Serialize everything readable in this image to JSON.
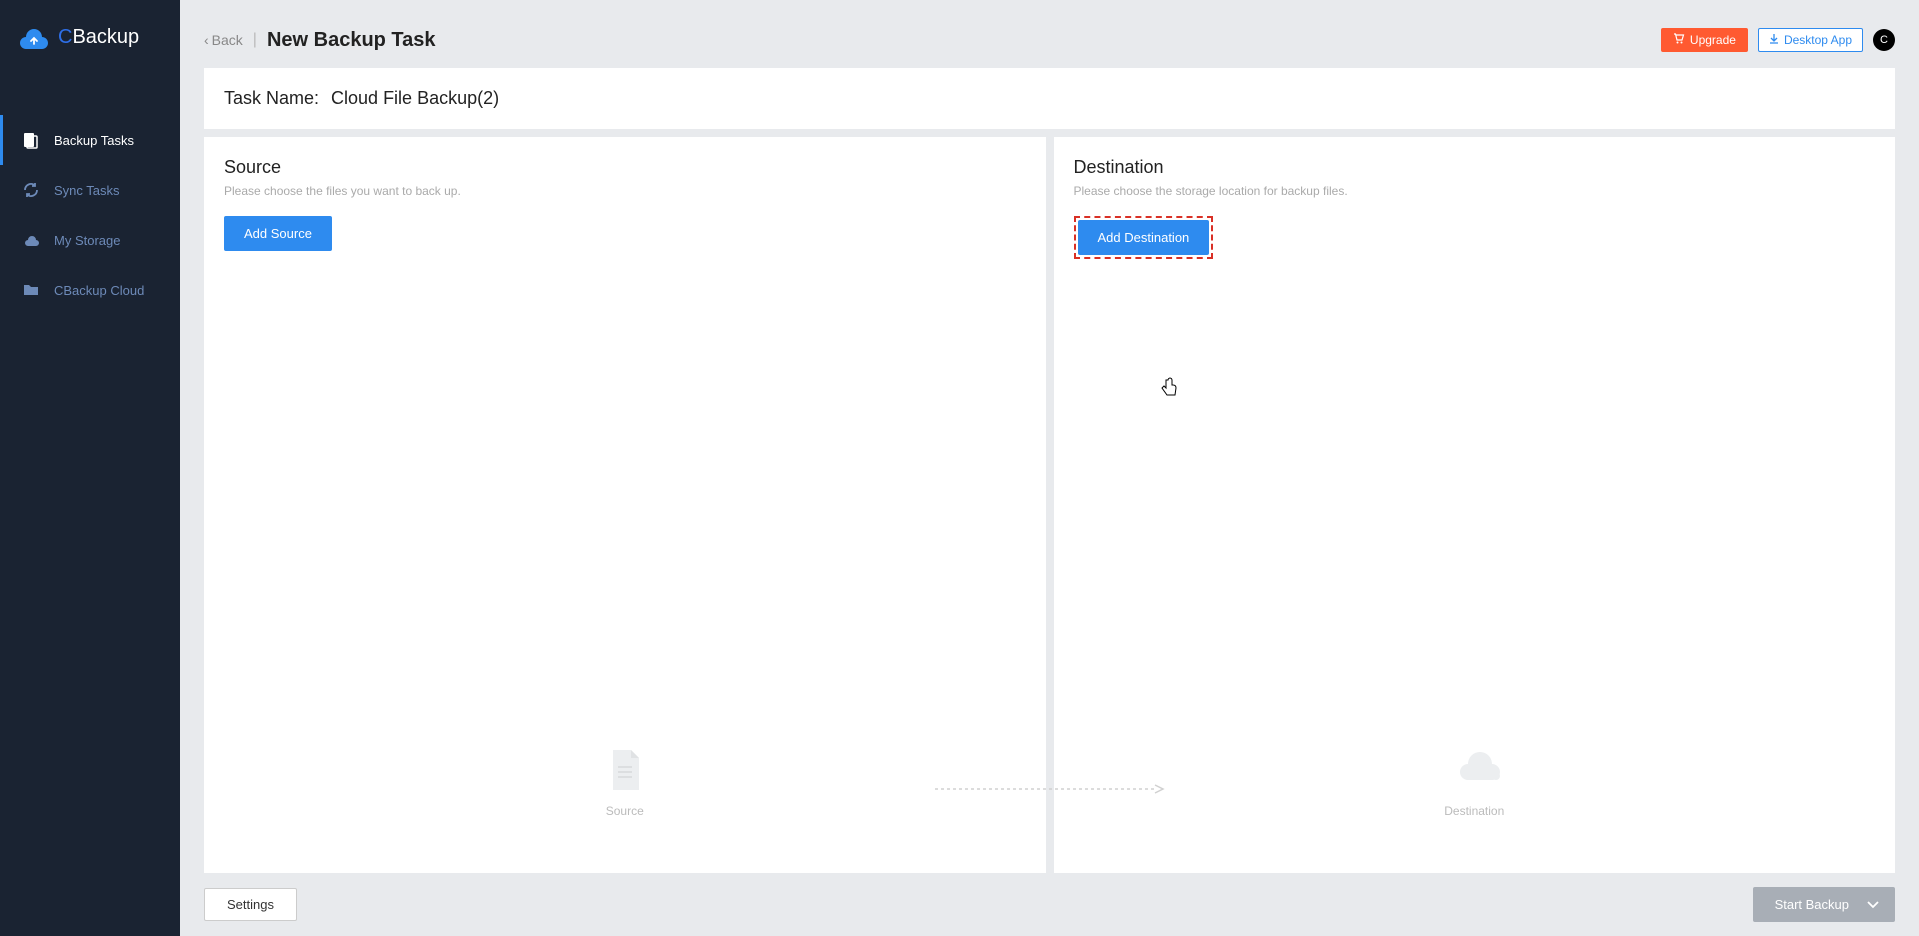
{
  "logo": {
    "prefix": "C",
    "rest": "Backup"
  },
  "sidebar": {
    "items": [
      {
        "label": "Backup Tasks",
        "icon": "backup"
      },
      {
        "label": "Sync Tasks",
        "icon": "sync"
      },
      {
        "label": "My Storage",
        "icon": "cloud"
      },
      {
        "label": "CBackup Cloud",
        "icon": "folder"
      }
    ]
  },
  "header": {
    "back": "Back",
    "title": "New Backup Task",
    "upgrade": "Upgrade",
    "desktop": "Desktop App",
    "avatar": "C"
  },
  "task": {
    "label": "Task Name:",
    "value": "Cloud File Backup(2)"
  },
  "source": {
    "title": "Source",
    "hint": "Please choose the files you want to back up.",
    "button": "Add Source",
    "placeholder": "Source"
  },
  "destination": {
    "title": "Destination",
    "hint": "Please choose the storage location for backup files.",
    "button": "Add Destination",
    "placeholder": "Destination"
  },
  "footer": {
    "settings": "Settings",
    "start": "Start Backup"
  }
}
